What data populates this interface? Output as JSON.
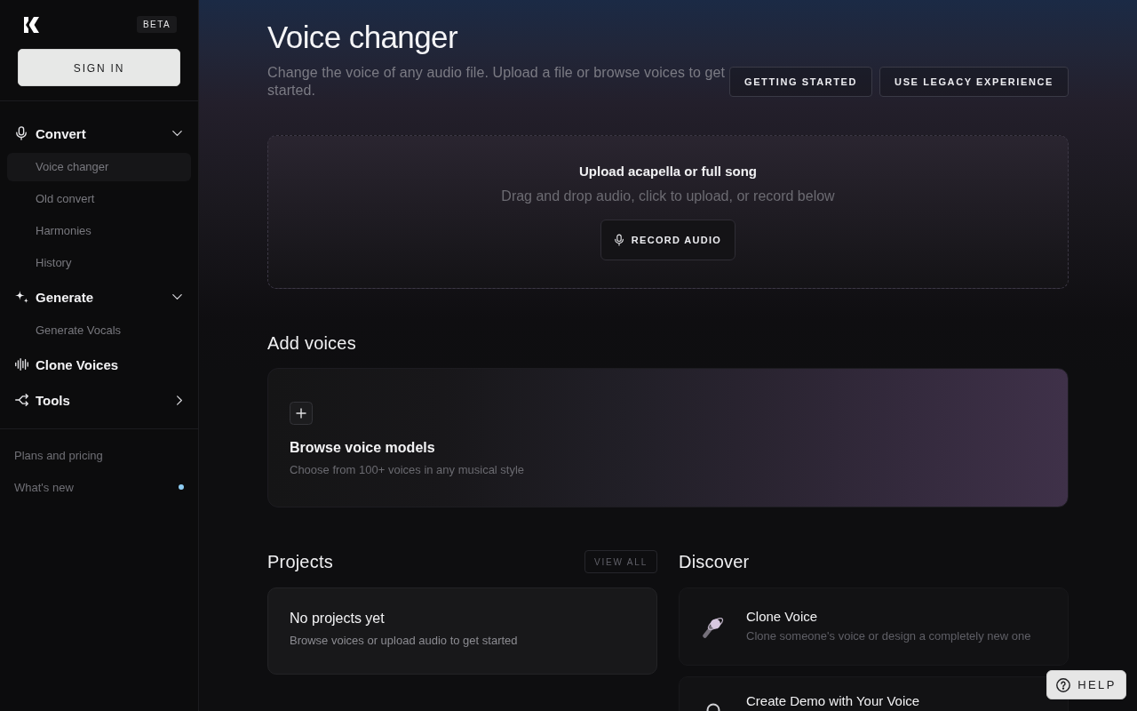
{
  "sidebar": {
    "badge": "BETA",
    "sign_in": "SIGN IN",
    "nav": [
      {
        "label": "Convert",
        "expanded": true,
        "children": [
          {
            "label": "Voice changer",
            "selected": true
          },
          {
            "label": "Old convert",
            "selected": false
          },
          {
            "label": "Harmonies",
            "selected": false
          },
          {
            "label": "History",
            "selected": false
          }
        ]
      },
      {
        "label": "Generate",
        "expanded": true,
        "children": [
          {
            "label": "Generate Vocals",
            "selected": false
          }
        ]
      },
      {
        "label": "Clone Voices"
      },
      {
        "label": "Tools",
        "expanded": false
      }
    ],
    "footer": [
      {
        "label": "Plans and pricing",
        "unread": false
      },
      {
        "label": "What's new",
        "unread": true
      }
    ]
  },
  "header": {
    "title": "Voice changer",
    "subtitle": "Change the voice of any audio file. Upload a file or browse voices to get started.",
    "buttons": [
      "GETTING STARTED",
      "USE LEGACY EXPERIENCE"
    ]
  },
  "upload": {
    "title": "Upload acapella or full song",
    "hint": "Drag and drop audio, click to upload, or record below",
    "button": "RECORD AUDIO"
  },
  "add_voices": {
    "heading": "Add voices",
    "card": {
      "title": "Browse voice models",
      "description": "Choose from 100+ voices in any musical style"
    }
  },
  "projects": {
    "heading": "Projects",
    "button": "VIEW ALL",
    "empty": {
      "title": "No projects yet",
      "description": "Browse voices or upload audio to get started"
    }
  },
  "discover": {
    "heading": "Discover",
    "items": [
      {
        "title": "Clone Voice",
        "description": "Clone someone's voice or design a completely new one"
      },
      {
        "title": "Create Demo with Your Voice"
      }
    ]
  },
  "help": "HELP"
}
